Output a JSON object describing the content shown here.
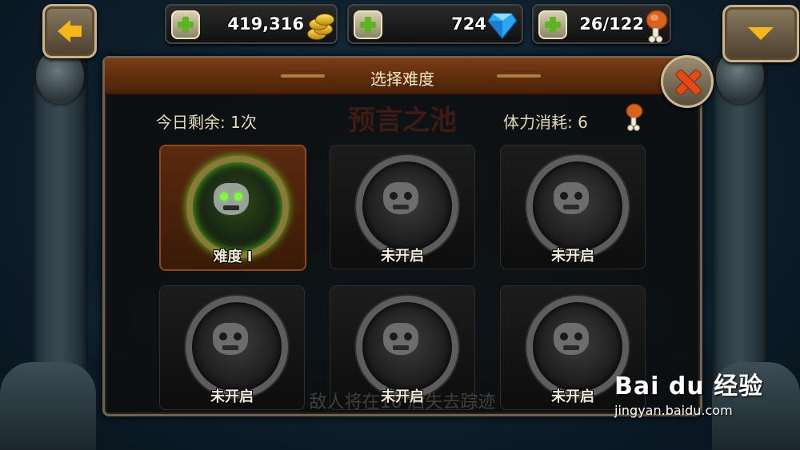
{
  "topbar": {
    "gold": "419,316",
    "gems": "724",
    "stamina": "26/122"
  },
  "panel": {
    "title": "选择难度",
    "background_title": "预言之池",
    "remaining": "今日剩余: 1次",
    "stamina_cost": "体力消耗:  6",
    "footer_ghost_text": "敌人将在16 后失去踪迹"
  },
  "difficulties": [
    {
      "label": "难度 I",
      "state": "unlocked"
    },
    {
      "label": "未开启",
      "state": "locked"
    },
    {
      "label": "未开启",
      "state": "locked"
    },
    {
      "label": "未开启",
      "state": "locked"
    },
    {
      "label": "未开启",
      "state": "locked"
    },
    {
      "label": "未开启",
      "state": "locked"
    }
  ],
  "watermark": {
    "brand": "Bai du 经验",
    "url": "jingyan.baidu.com"
  },
  "icons": {
    "back": "arrow-left-icon",
    "menu": "arrow-down-icon",
    "close": "close-icon",
    "gold": "coin-stack-icon",
    "gems": "diamond-icon",
    "stamina": "meat-drumstick-icon"
  },
  "colors": {
    "accent_orange": "#f6b619",
    "title_bar": "#7a3c14",
    "plus_green": "#5fb422",
    "close_red": "#e24a1a",
    "active_glow": "#7cff3a"
  }
}
